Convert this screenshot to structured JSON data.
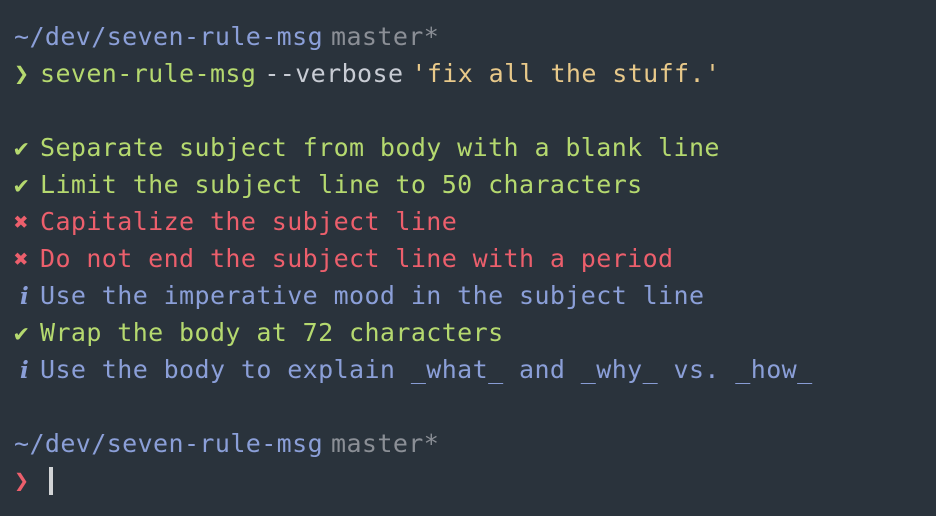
{
  "terminal": {
    "background_color": "#2a333c",
    "prompt_top": {
      "path": "~/dev/seven-rule-msg",
      "branch": "master*",
      "chevron": "❯",
      "chevron_color": "#b5d96f",
      "command": "seven-rule-msg",
      "flag": "--verbose",
      "argument": "'fix all the stuff.'"
    },
    "results": [
      {
        "mark": "✔",
        "status": "pass",
        "color": "#b5d96f",
        "text": "Separate subject from body with a blank line"
      },
      {
        "mark": "✔",
        "status": "pass",
        "color": "#b5d96f",
        "text": "Limit the subject line to 50 characters"
      },
      {
        "mark": "✖",
        "status": "fail",
        "color": "#ec5f6c",
        "text": "Capitalize the subject line"
      },
      {
        "mark": "✖",
        "status": "fail",
        "color": "#ec5f6c",
        "text": "Do not end the subject line with a period"
      },
      {
        "mark": "i",
        "status": "info",
        "color": "#8b9fd8",
        "text": "Use the imperative mood in the subject line"
      },
      {
        "mark": "✔",
        "status": "pass",
        "color": "#b5d96f",
        "text": "Wrap the body at 72 characters"
      },
      {
        "mark": "i",
        "status": "info",
        "color": "#8b9fd8",
        "text": "Use the body to explain _what_ and _why_ vs. _how_"
      }
    ],
    "prompt_bottom": {
      "path": "~/dev/seven-rule-msg",
      "branch": "master*",
      "chevron": "❯",
      "chevron_color": "#ec5f6c",
      "input": ""
    }
  }
}
